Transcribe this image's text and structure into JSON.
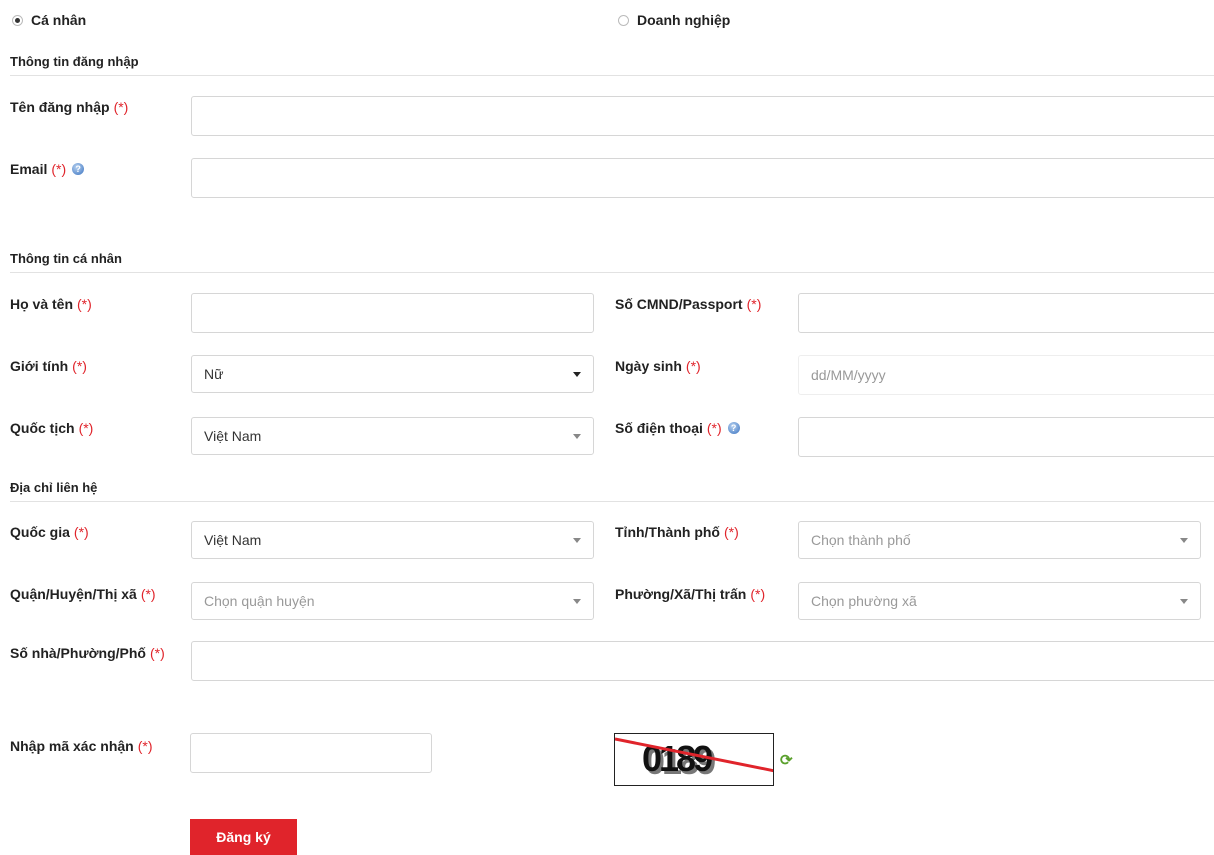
{
  "account_type": {
    "individual": "Cá nhân",
    "business": "Doanh nghiệp",
    "selected": "individual"
  },
  "required_mark": "(*)",
  "login_section": {
    "title": "Thông tin đăng nhập",
    "username_label": "Tên đăng nhập",
    "email_label": "Email"
  },
  "personal_section": {
    "title": "Thông tin cá nhân",
    "fullname_label": "Họ và tên",
    "id_label": "Số CMND/Passport",
    "gender_label": "Giới tính",
    "gender_value": "Nữ",
    "dob_label": "Ngày sinh",
    "dob_placeholder": "dd/MM/yyyy",
    "nationality_label": "Quốc tịch",
    "nationality_value": "Việt Nam",
    "phone_label": "Số điện thoại"
  },
  "address_section": {
    "title": "Địa chỉ liên hệ",
    "country_label": "Quốc gia",
    "country_value": "Việt Nam",
    "city_label": "Tỉnh/Thành phố",
    "city_placeholder": "Chọn thành phố",
    "district_label": "Quận/Huyện/Thị xã",
    "district_placeholder": "Chọn quận huyện",
    "ward_label": "Phường/Xã/Thị trấn",
    "ward_placeholder": "Chọn phường xã",
    "street_label": "Số nhà/Phường/Phố"
  },
  "captcha": {
    "label": "Nhập mã xác nhận",
    "code": "0189"
  },
  "submit_label": "Đăng ký",
  "colors": {
    "accent": "#e0242b",
    "required": "#e0242b",
    "border": "#d6d6d6"
  }
}
